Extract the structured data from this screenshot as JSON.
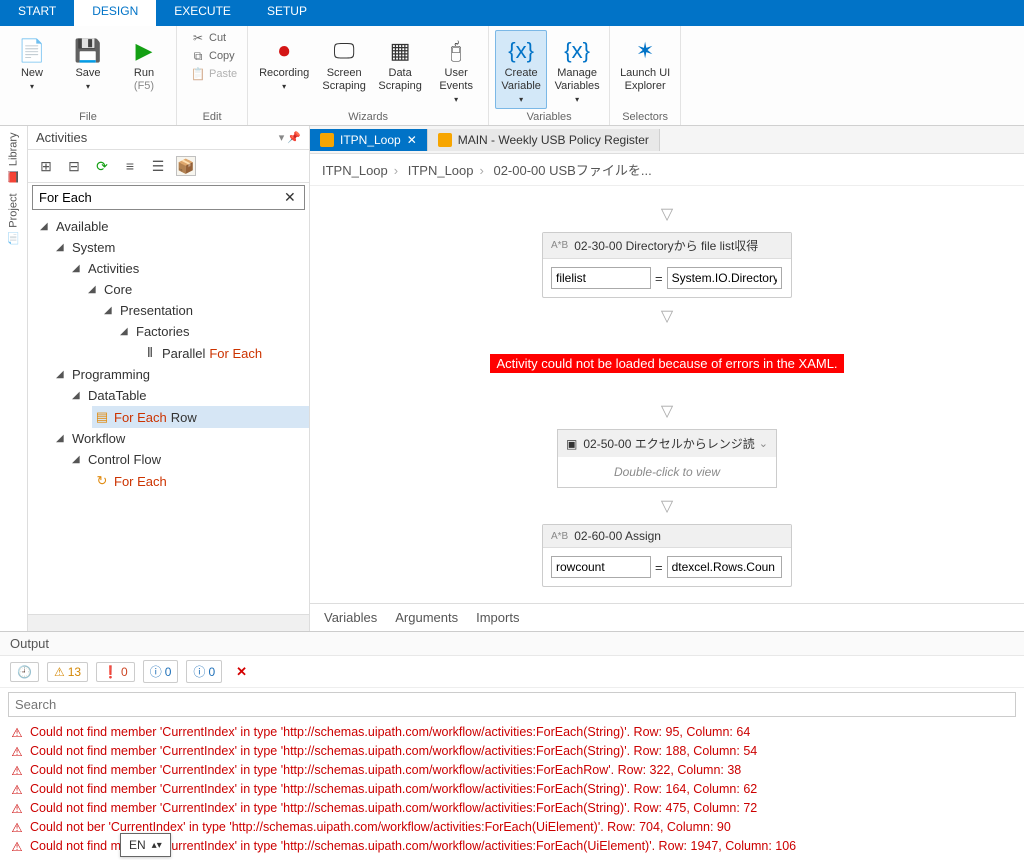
{
  "tabs": {
    "start": "START",
    "design": "DESIGN",
    "execute": "EXECUTE",
    "setup": "SETUP"
  },
  "ribbon": {
    "new": "New",
    "save": "Save",
    "run": "Run",
    "run_sub": "(F5)",
    "cut": "Cut",
    "copy": "Copy",
    "paste": "Paste",
    "recording": "Recording",
    "screen": "Screen\nScraping",
    "data": "Data\nScraping",
    "user": "User\nEvents",
    "create_var": "Create\nVariable",
    "manage_var": "Manage\nVariables",
    "launch_ui": "Launch UI\nExplorer",
    "group_file": "File",
    "group_edit": "Edit",
    "group_wizards": "Wizards",
    "group_vars": "Variables",
    "group_sel": "Selectors"
  },
  "left": {
    "library": "Library",
    "project": "Project"
  },
  "activities": {
    "title": "Activities",
    "search": "For Each",
    "tree": {
      "available": "Available",
      "system": "System",
      "activities_label": "Activities",
      "core": "Core",
      "presentation": "Presentation",
      "factories": "Factories",
      "parallel_prefix": "Parallel ",
      "parallel_hl": "For Each",
      "programming": "Programming",
      "datatable": "DataTable",
      "foreachrow_hl": "For Each",
      "foreachrow_suffix": " Row",
      "workflow": "Workflow",
      "controlflow": "Control Flow",
      "foreach": "For Each"
    }
  },
  "docs": {
    "tab1": "ITPN_Loop",
    "tab2": "MAIN - Weekly USB Policy Register"
  },
  "bread": {
    "a": "ITPN_Loop",
    "b": "ITPN_Loop",
    "c": "02-00-00 USBファイルを..."
  },
  "act1": {
    "title": "02-30-00 Directoryから file list収得",
    "var": "filelist",
    "val": "System.IO.Directory"
  },
  "err": "Activity could not be loaded because of errors in the XAML.",
  "act2": {
    "title": "02-50-00 エクセルからレンジ読",
    "hint": "Double-click to view"
  },
  "act3": {
    "title": "02‐60‐00 Assign",
    "var": "rowcount",
    "val": "dtexcel.Rows.Coun"
  },
  "panel_tabs": {
    "vars": "Variables",
    "args": "Arguments",
    "imports": "Imports"
  },
  "output": {
    "title": "Output",
    "counts": {
      "warn": "13",
      "err": "0",
      "info1": "0",
      "info2": "0"
    },
    "search_ph": "Search",
    "rows": [
      "Could not find member 'CurrentIndex' in type 'http://schemas.uipath.com/workflow/activities:ForEach(String)'. Row: 95, Column: 64",
      "Could not find member 'CurrentIndex' in type 'http://schemas.uipath.com/workflow/activities:ForEach(String)'. Row: 188, Column: 54",
      "Could not find member 'CurrentIndex' in type 'http://schemas.uipath.com/workflow/activities:ForEachRow'. Row: 322, Column: 38",
      "Could not find member 'CurrentIndex' in type 'http://schemas.uipath.com/workflow/activities:ForEach(String)'. Row: 164, Column: 62",
      "Could not find member 'CurrentIndex' in type 'http://schemas.uipath.com/workflow/activities:ForEach(String)'. Row: 475, Column: 72",
      "Could not       ber 'CurrentIndex' in type 'http://schemas.uipath.com/workflow/activities:ForEach(UiElement)'. Row: 704, Column: 90",
      "Could not find member 'CurrentIndex' in type 'http://schemas.uipath.com/workflow/activities:ForEach(UiElement)'. Row: 1947, Column: 106"
    ]
  },
  "lang": "EN"
}
